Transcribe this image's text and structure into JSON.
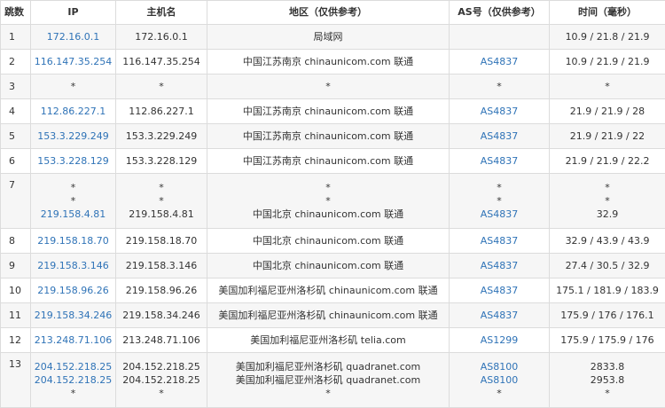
{
  "headers": {
    "hop": "跳数",
    "ip": "IP",
    "hostname": "主机名",
    "region": "地区（仅供参考）",
    "as": "AS号（仅供参考）",
    "time": "时间（毫秒）"
  },
  "colors": {
    "link": "#2f73b7",
    "text": "#333333",
    "border": "#dcdcdc",
    "stripe": "#f6f6f6"
  },
  "rows": [
    {
      "hop": "1",
      "ip": [
        "172.16.0.1"
      ],
      "hostname": [
        "172.16.0.1"
      ],
      "region": [
        "局域网"
      ],
      "as": [
        ""
      ],
      "time": [
        "10.9 / 21.8 / 21.9"
      ]
    },
    {
      "hop": "2",
      "ip": [
        "116.147.35.254"
      ],
      "hostname": [
        "116.147.35.254"
      ],
      "region": [
        "中国江苏南京 chinaunicom.com 联通"
      ],
      "as": [
        "AS4837"
      ],
      "time": [
        "10.9 / 21.9 / 21.9"
      ]
    },
    {
      "hop": "3",
      "ip": [
        "*"
      ],
      "hostname": [
        "*"
      ],
      "region": [
        "*"
      ],
      "as": [
        "*"
      ],
      "time": [
        "*"
      ]
    },
    {
      "hop": "4",
      "ip": [
        "112.86.227.1"
      ],
      "hostname": [
        "112.86.227.1"
      ],
      "region": [
        "中国江苏南京 chinaunicom.com 联通"
      ],
      "as": [
        "AS4837"
      ],
      "time": [
        "21.9 / 21.9 / 28"
      ]
    },
    {
      "hop": "5",
      "ip": [
        "153.3.229.249"
      ],
      "hostname": [
        "153.3.229.249"
      ],
      "region": [
        "中国江苏南京 chinaunicom.com 联通"
      ],
      "as": [
        "AS4837"
      ],
      "time": [
        "21.9 / 21.9 / 22"
      ]
    },
    {
      "hop": "6",
      "ip": [
        "153.3.228.129"
      ],
      "hostname": [
        "153.3.228.129"
      ],
      "region": [
        "中国江苏南京 chinaunicom.com 联通"
      ],
      "as": [
        "AS4837"
      ],
      "time": [
        "21.9 / 21.9 / 22.2"
      ]
    },
    {
      "hop": "7",
      "ip": [
        "*",
        "*",
        "219.158.4.81"
      ],
      "hostname": [
        "*",
        "*",
        "219.158.4.81"
      ],
      "region": [
        "*",
        "*",
        "中国北京 chinaunicom.com 联通"
      ],
      "as": [
        "*",
        "*",
        "AS4837"
      ],
      "time": [
        "*",
        "*",
        "32.9"
      ]
    },
    {
      "hop": "8",
      "ip": [
        "219.158.18.70"
      ],
      "hostname": [
        "219.158.18.70"
      ],
      "region": [
        "中国北京 chinaunicom.com 联通"
      ],
      "as": [
        "AS4837"
      ],
      "time": [
        "32.9 / 43.9 / 43.9"
      ]
    },
    {
      "hop": "9",
      "ip": [
        "219.158.3.146"
      ],
      "hostname": [
        "219.158.3.146"
      ],
      "region": [
        "中国北京 chinaunicom.com 联通"
      ],
      "as": [
        "AS4837"
      ],
      "time": [
        "27.4 / 30.5 / 32.9"
      ]
    },
    {
      "hop": "10",
      "ip": [
        "219.158.96.26"
      ],
      "hostname": [
        "219.158.96.26"
      ],
      "region": [
        "美国加利福尼亚州洛杉矶 chinaunicom.com 联通"
      ],
      "as": [
        "AS4837"
      ],
      "time": [
        "175.1 / 181.9 / 183.9"
      ]
    },
    {
      "hop": "11",
      "ip": [
        "219.158.34.246"
      ],
      "hostname": [
        "219.158.34.246"
      ],
      "region": [
        "美国加利福尼亚州洛杉矶 chinaunicom.com 联通"
      ],
      "as": [
        "AS4837"
      ],
      "time": [
        "175.9 / 176 / 176.1"
      ]
    },
    {
      "hop": "12",
      "ip": [
        "213.248.71.106"
      ],
      "hostname": [
        "213.248.71.106"
      ],
      "region": [
        "美国加利福尼亚州洛杉矶 telia.com"
      ],
      "as": [
        "AS1299"
      ],
      "time": [
        "175.9 / 175.9 / 176"
      ]
    },
    {
      "hop": "13",
      "ip": [
        "204.152.218.25",
        "204.152.218.25",
        "*"
      ],
      "hostname": [
        "204.152.218.25",
        "204.152.218.25",
        "*"
      ],
      "region": [
        "美国加利福尼亚州洛杉矶 quadranet.com",
        "美国加利福尼亚州洛杉矶 quadranet.com",
        "*"
      ],
      "as": [
        "AS8100",
        "AS8100",
        "*"
      ],
      "time": [
        "2833.8",
        "2953.8",
        "*"
      ]
    }
  ]
}
